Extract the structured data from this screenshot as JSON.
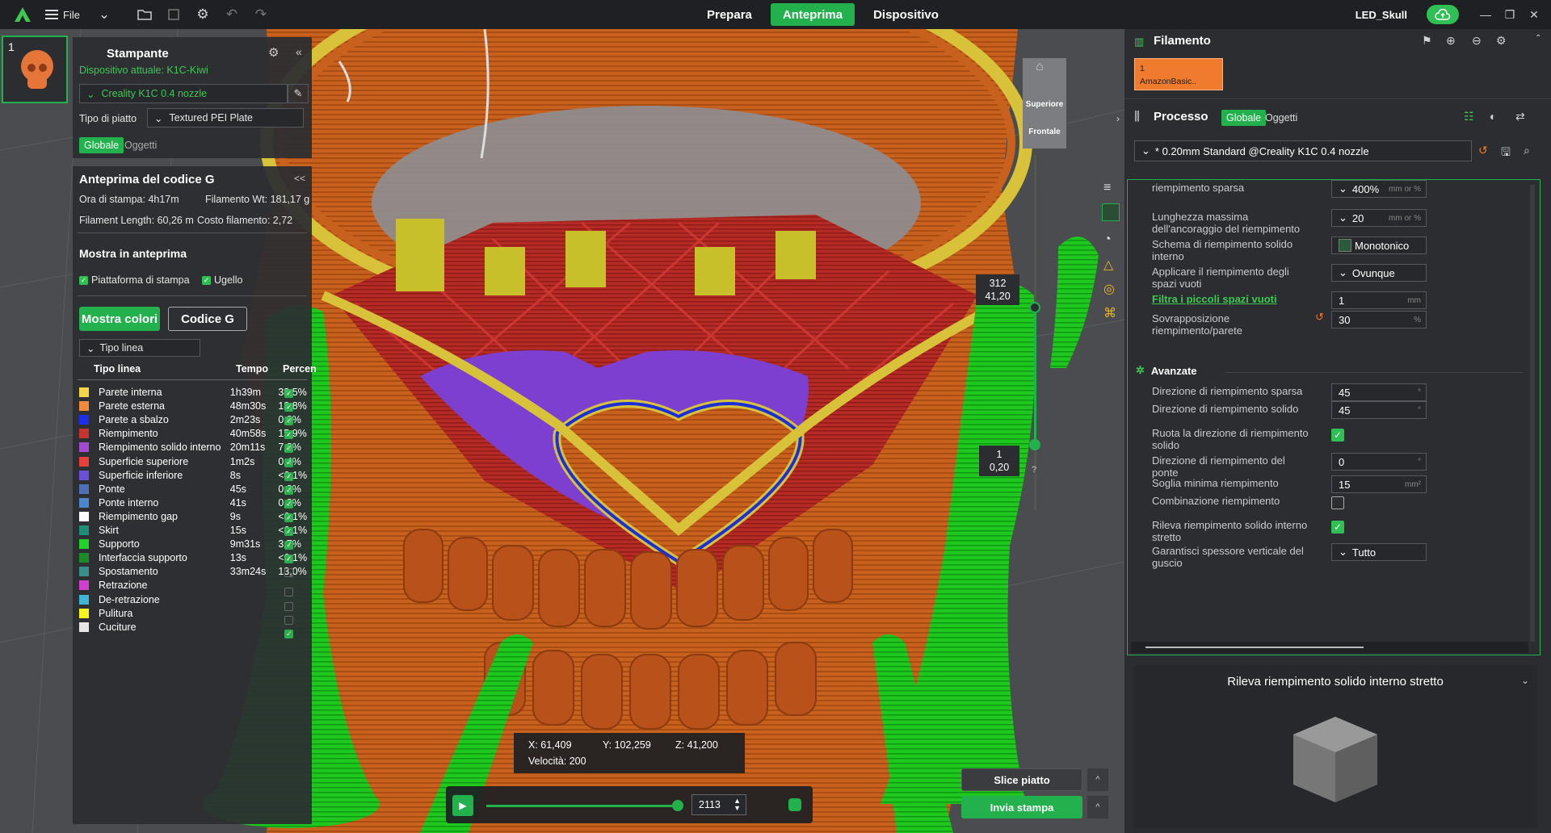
{
  "topbar": {
    "file_label": "File",
    "tabs": [
      {
        "label": "Prepara",
        "active": false
      },
      {
        "label": "Anteprima",
        "active": true
      },
      {
        "label": "Dispositivo",
        "active": false
      }
    ],
    "project_name": "LED_Skull"
  },
  "plate": {
    "number": "1"
  },
  "printer": {
    "title": "Stampante",
    "current_device": "Dispositivo attuale: K1C-Kiwi",
    "nozzle": "Creality K1C 0.4 nozzle",
    "plate_type_label": "Tipo di piatto",
    "plate_type": "Textured PEI Plate",
    "scope_global": "Globale",
    "scope_objects": "Oggetti"
  },
  "gcode": {
    "title": "Anteprima del codice G",
    "print_time": "Ora di stampa: 4h17m",
    "filament_wt": "Filamento Wt: 181,17 g",
    "filament_length": "Filament Length: 60,26 m",
    "filament_cost": "Costo filamento: 2,72",
    "show_title": "Mostra in anteprima",
    "show_platform": "Piattaforma di stampa",
    "show_nozzle": "Ugello",
    "btn_colors": "Mostra colori",
    "btn_gcode": "Codice G",
    "line_type_select": "Tipo linea",
    "col_type": "Tipo linea",
    "col_time": "Tempo",
    "col_pct": "Percen",
    "legend": [
      {
        "name": "Parete interna",
        "time": "1h39m",
        "pct": "38,5%",
        "color": "#f5d547",
        "checked": true
      },
      {
        "name": "Parete esterna",
        "time": "48m30s",
        "pct": "18,8%",
        "color": "#f08a3c",
        "checked": true
      },
      {
        "name": "Parete a sbalzo",
        "time": "2m23s",
        "pct": "0,9%",
        "color": "#1f2ee8",
        "checked": true
      },
      {
        "name": "Riempimento",
        "time": "40m58s",
        "pct": "15,9%",
        "color": "#c7332f",
        "checked": true
      },
      {
        "name": "Riempimento solido interno",
        "time": "20m11s",
        "pct": "7,8%",
        "color": "#a24ad1",
        "checked": true
      },
      {
        "name": "Superficie superiore",
        "time": "1m2s",
        "pct": "0,4%",
        "color": "#e8413a",
        "checked": true
      },
      {
        "name": "Superficie inferiore",
        "time": "8s",
        "pct": "<0,1%",
        "color": "#6e4fd9",
        "checked": true
      },
      {
        "name": "Ponte",
        "time": "45s",
        "pct": "0,3%",
        "color": "#4f6fb8",
        "checked": true
      },
      {
        "name": "Ponte interno",
        "time": "41s",
        "pct": "0,3%",
        "color": "#4a86c9",
        "checked": true
      },
      {
        "name": "Riempimento gap",
        "time": "9s",
        "pct": "<0,1%",
        "color": "#ffffff",
        "checked": true
      },
      {
        "name": "Skirt",
        "time": "15s",
        "pct": "<0,1%",
        "color": "#1f8f7a",
        "checked": true
      },
      {
        "name": "Supporto",
        "time": "9m31s",
        "pct": "3,7%",
        "color": "#22d12b",
        "checked": true
      },
      {
        "name": "Interfaccia supporto",
        "time": "13s",
        "pct": "<0,1%",
        "color": "#1d8a2a",
        "checked": true
      },
      {
        "name": "Spostamento",
        "time": "33m24s",
        "pct": "13,0%",
        "color": "#3a8f8a",
        "checked": false
      },
      {
        "name": "Retrazione",
        "time": "",
        "pct": "",
        "color": "#d13fd1",
        "checked": false
      },
      {
        "name": "De-retrazione",
        "time": "",
        "pct": "",
        "color": "#3fb4d6",
        "checked": false
      },
      {
        "name": "Pulitura",
        "time": "",
        "pct": "",
        "color": "#f5f51f",
        "checked": false
      },
      {
        "name": "Cuciture",
        "time": "",
        "pct": "",
        "color": "#e6e6e6",
        "checked": true
      }
    ]
  },
  "view_cube": {
    "top": "Superiore",
    "front": "Frontale"
  },
  "layer_slider": {
    "top_layer": "312",
    "top_height": "41,20",
    "bottom_layer": "1",
    "bottom_height": "0,20",
    "help": "?"
  },
  "coords": {
    "x": "X: 61,409",
    "y": "Y: 102,259",
    "z": "Z: 41,200",
    "speed": "Velocità: 200"
  },
  "playback": {
    "value": "2113"
  },
  "actions": {
    "slice": "Slice piatto",
    "send": "Invia stampa"
  },
  "filament": {
    "title": "Filamento",
    "slot_number": "1",
    "slot_name": "AmazonBasic..",
    "slot_color": "#f07a2e"
  },
  "process": {
    "title": "Processo",
    "scope_global": "Globale",
    "scope_objects": "Oggetti",
    "preset": "* 0.20mm Standard @Creality K1C 0.4 nozzle",
    "settings_top": [
      {
        "label": "riempimento sparsa",
        "value": "400%",
        "unit": "mm or %"
      },
      {
        "label": "Lunghezza massima dell'ancoraggio del riempimento",
        "value": "20",
        "unit": "mm or %"
      },
      {
        "label": "Schema di riempimento solido interno",
        "value": "Monotonico",
        "unit": ""
      },
      {
        "label": "Applicare il riempimento degli spazi vuoti",
        "value": "Ovunque",
        "unit": ""
      },
      {
        "label": "Filtra i piccoli spazi vuoti",
        "value": "1",
        "unit": "mm"
      },
      {
        "label": "Sovrapposizione riempimento/parete",
        "value": "30",
        "unit": "%"
      }
    ],
    "advanced_title": "Avanzate",
    "settings_adv": [
      {
        "label": "Direzione di riempimento sparsa",
        "value": "45",
        "unit": "°"
      },
      {
        "label": "Direzione di riempimento solido",
        "value": "45",
        "unit": "°"
      },
      {
        "label": "Ruota la direzione di riempimento solido",
        "value": "",
        "unit": ""
      },
      {
        "label": "Direzione di riempimento del ponte",
        "value": "0",
        "unit": "°"
      },
      {
        "label": "Soglia minima riempimento",
        "value": "15",
        "unit": "mm²"
      },
      {
        "label": "Combinazione riempimento",
        "value": "",
        "unit": ""
      },
      {
        "label": "Rileva riempimento solido interno stretto",
        "value": "",
        "unit": ""
      },
      {
        "label": "Garantisci spessore verticale del guscio",
        "value": "Tutto",
        "unit": ""
      }
    ]
  },
  "help_preview": {
    "title": "Rileva riempimento solido interno stretto"
  }
}
